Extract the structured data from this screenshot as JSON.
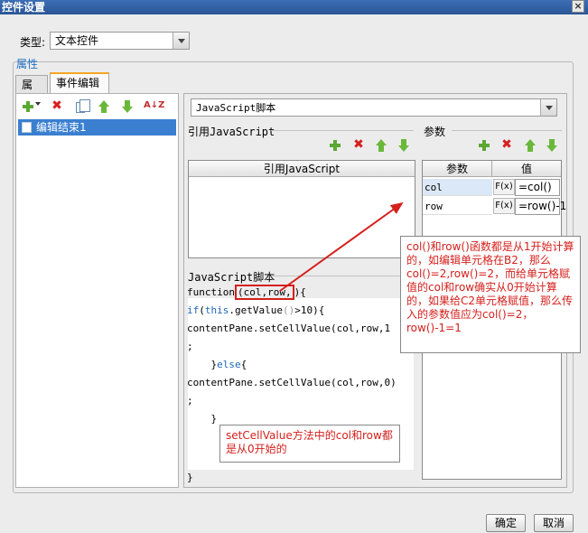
{
  "window": {
    "title": "控件设置"
  },
  "type_row": {
    "label": "类型:",
    "selected": "文本控件"
  },
  "group": {
    "label": "属性"
  },
  "tabs": [
    {
      "label": "属性"
    },
    {
      "label": "事件编辑"
    }
  ],
  "event_list": {
    "items": [
      {
        "label": "编辑结束1"
      }
    ]
  },
  "script_type": {
    "selected": "JavaScript脚本"
  },
  "ref_js": {
    "section_title": "引用JavaScript",
    "column_header": "引用JavaScript"
  },
  "params": {
    "section_title": "参数",
    "headers": [
      "参数",
      "值"
    ],
    "rows": [
      {
        "name": "col",
        "fx": "F(x)",
        "value": "=col()"
      },
      {
        "name": "row",
        "fx": "F(x)",
        "value": "=row()-1"
      }
    ]
  },
  "script": {
    "section_title": "JavaScript脚本",
    "line1_pre": "function",
    "line1_highlight": "(col,row,",
    "line1_post": ")",
    "line1_brace": "{",
    "line2_kw_if": "if",
    "line2_kw_this": "this",
    "line2_rest_a": ".getValue",
    "line2_rest_b": "()",
    "line2_rest_c": ">10){",
    "line3": "contentPane.setCellValue(col,row,1",
    "line4": ";",
    "line5_pre": "    }",
    "line5_kw": "else",
    "line5_post": "{",
    "line6": "contentPane.setCellValue(col,row,0)",
    "line7": ";",
    "line8": "    }",
    "last": "}"
  },
  "annotations": {
    "callout_right": "col()和row()函数都是从1开始计算的，如编辑单元格在B2，那么col()=2,row()=2，而给单元格赋值的col和row确实从0开始计算的，如果给C2单元格赋值，那么传入的参数值应为col()=2，row()-1=1",
    "callout_bottom": "setCellValue方法中的col和row都是从0开始的"
  },
  "buttons": {
    "ok": "确定",
    "cancel": "取消"
  },
  "colors": {
    "accent_tab": "#f5a623",
    "selection": "#3a7fd0",
    "annotation": "#d4211d",
    "icon_green": "#6ab83a",
    "icon_red": "#d81e1e"
  }
}
